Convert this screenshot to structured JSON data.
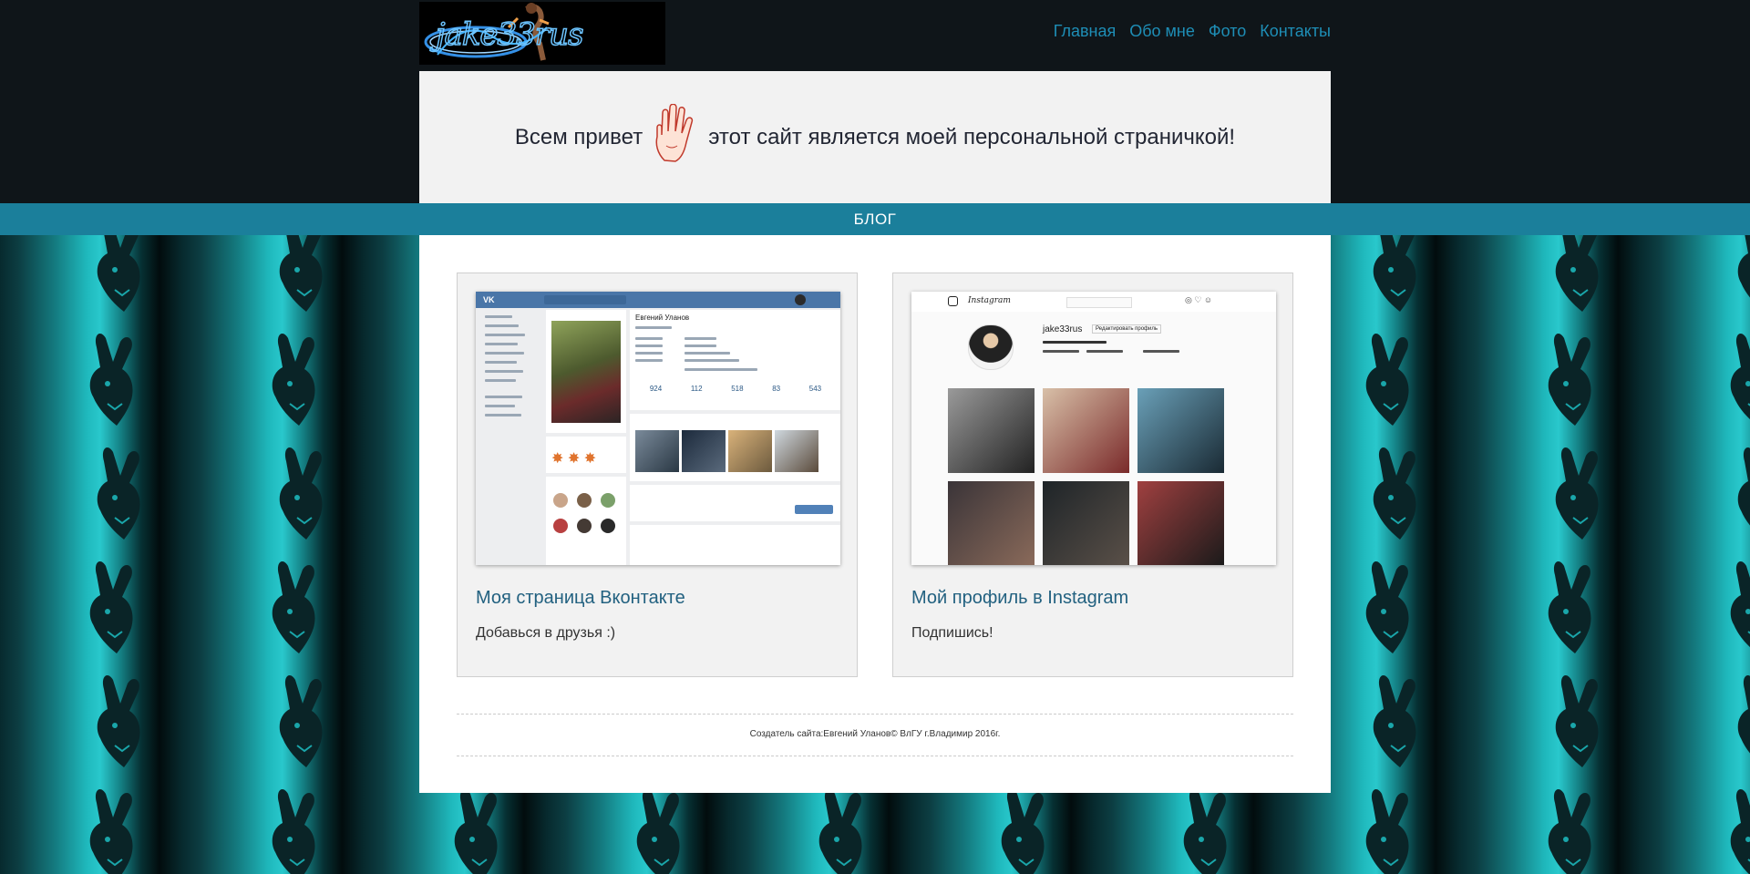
{
  "nav": {
    "logo_text": "jake33rus",
    "links": [
      "Главная",
      "Обо мне",
      "Фото",
      "Контакты"
    ]
  },
  "hero": {
    "greeting": "Всем привет",
    "message": "этот сайт является моей персональной страничкой!"
  },
  "blog_bar": {
    "label": "БЛОГ"
  },
  "cards": [
    {
      "title": "Моя страница Вконтакте",
      "text": "Добавься в друзья :)"
    },
    {
      "title": "Мой профиль в Instagram",
      "text": "Подпишись!"
    }
  ],
  "vk_mock": {
    "profile_name": "Евгений Уланов",
    "stats": [
      "924",
      "112",
      "518",
      "83",
      "543"
    ]
  },
  "ig_mock": {
    "brand": "Instagram",
    "username": "jake33rus",
    "edit_button": "Редактировать профиль"
  },
  "footer": {
    "credit": "Создатель сайта:Евгений Уланов© ВлГУ г.Владимир 2016г."
  },
  "colors": {
    "nav_link": "#1e8eb6",
    "blog_bar": "#1b7f9b",
    "card_title": "#226180",
    "pattern_teal": "#29c8cc"
  }
}
